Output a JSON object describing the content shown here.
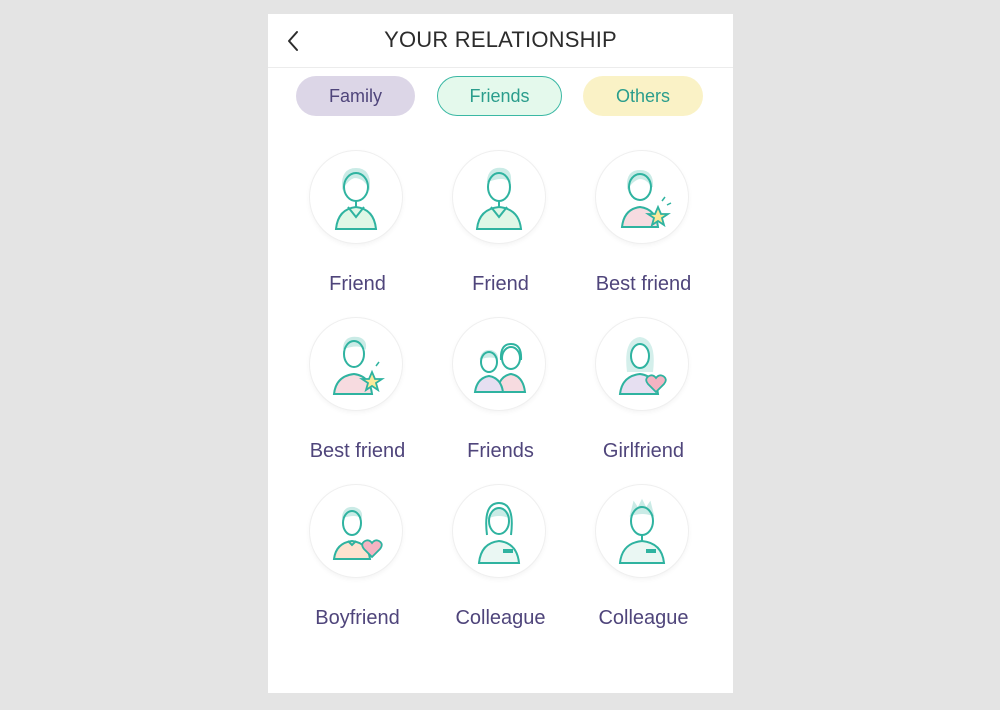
{
  "header": {
    "title": "YOUR RELATIONSHIP"
  },
  "tabs": [
    {
      "label": "Family"
    },
    {
      "label": "Friends"
    },
    {
      "label": "Others"
    }
  ],
  "items": [
    {
      "label": "Friend",
      "icon": "friend-female-icon"
    },
    {
      "label": "Friend",
      "icon": "friend-male-icon"
    },
    {
      "label": "Best friend",
      "icon": "best-friend-female-icon"
    },
    {
      "label": "Best friend",
      "icon": "best-friend-male-icon"
    },
    {
      "label": "Friends",
      "icon": "friends-group-icon"
    },
    {
      "label": "Girlfriend",
      "icon": "girlfriend-icon"
    },
    {
      "label": "Boyfriend",
      "icon": "boyfriend-icon"
    },
    {
      "label": "Colleague",
      "icon": "colleague-female-icon"
    },
    {
      "label": "Colleague",
      "icon": "colleague-male-icon"
    }
  ],
  "colors": {
    "accent_teal": "#3bb8a4",
    "label_purple": "#4f457b",
    "family_tab_bg": "#dcd6e7",
    "friends_tab_bg": "#e4f9ec",
    "others_tab_bg": "#faf2c6"
  }
}
